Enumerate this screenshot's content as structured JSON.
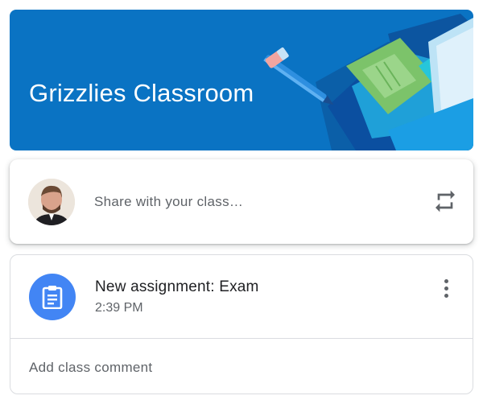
{
  "banner": {
    "title": "Grizzlies Classroom",
    "background_color": "#0a73c3"
  },
  "share_box": {
    "placeholder": "Share with your class…",
    "avatar_icon": "user-avatar",
    "action_icon": "repost-icon"
  },
  "posts": [
    {
      "icon": "assignment-icon",
      "title": "New assignment: Exam",
      "time": "2:39 PM",
      "menu_icon": "more-vert-icon",
      "comment_label": "Add class comment"
    }
  ],
  "colors": {
    "accent_blue": "#4285f4",
    "text_primary": "#202124",
    "text_secondary": "#5f6368",
    "border": "#dadce0"
  }
}
